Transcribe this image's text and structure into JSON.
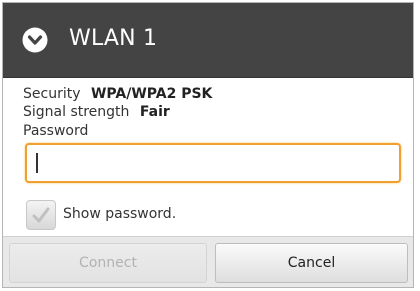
{
  "dialog": {
    "title": "WLAN 1",
    "title_icon": "wifi-circle-chevron-icon"
  },
  "details": {
    "security_label": "Security",
    "security_value": "WPA/WPA2 PSK",
    "signal_label": "Signal strength",
    "signal_value": "Fair",
    "password_label": "Password"
  },
  "password_field": {
    "value": "",
    "placeholder": ""
  },
  "show_password": {
    "label": "Show password.",
    "checked": true
  },
  "buttons": {
    "connect": "Connect",
    "cancel": "Cancel"
  },
  "colors": {
    "titlebar": "#444444",
    "focus_border": "#f0a030"
  }
}
